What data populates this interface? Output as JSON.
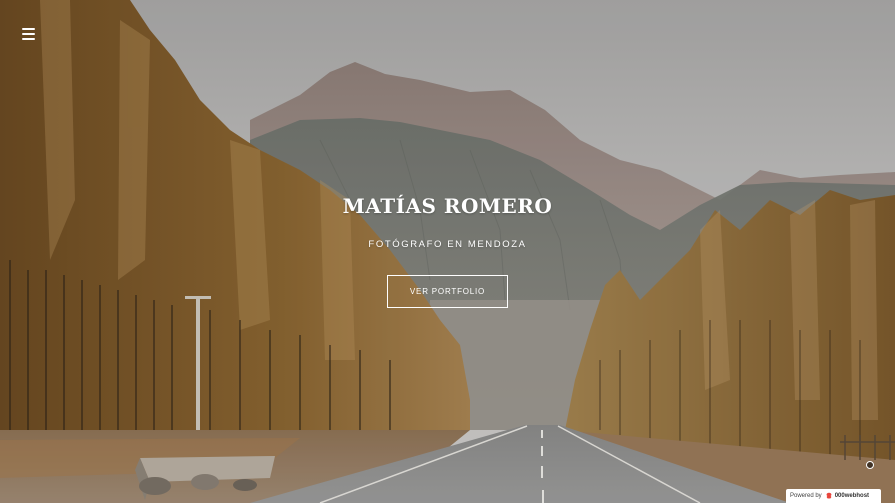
{
  "hero": {
    "title": "MATÍAS ROMERO",
    "subtitle": "FOTÓGRAFO EN MENDOZA",
    "cta_label": "VER PORTFOLIO"
  },
  "nav": {
    "menu_icon": "hamburger-menu-icon"
  },
  "footer_badge": {
    "prefix": "Powered by",
    "brand": "000webhost",
    "logo_icon": "webhost-logo-icon"
  },
  "colors": {
    "text": "#ffffff",
    "sky": "#bdbcbb",
    "badge_bg": "#ffffff",
    "brand_red": "#e8453c"
  }
}
